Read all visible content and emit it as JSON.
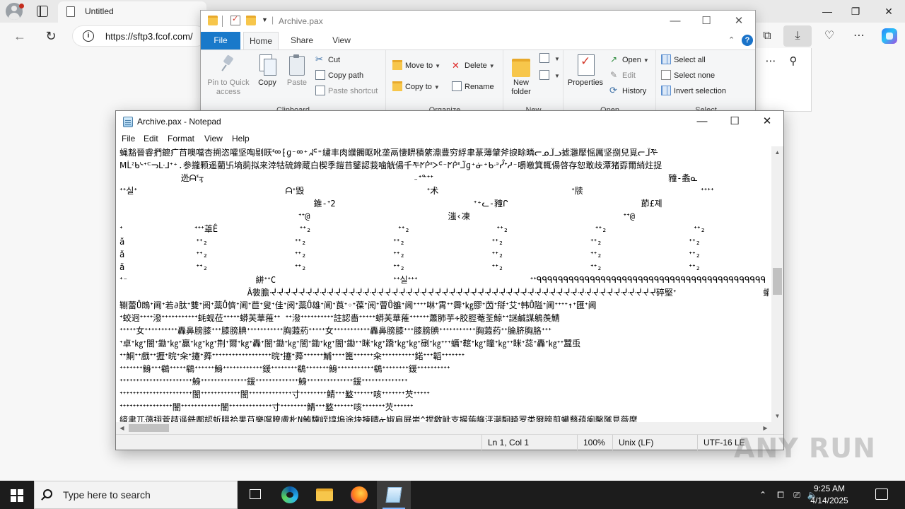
{
  "edge": {
    "tab_title": "Untitled",
    "url": "https://sftp3.fcof.com/",
    "minimize": "—",
    "restore": "❐",
    "close": "✕",
    "more": "⋯",
    "pin": "📌",
    "toolbar_more": "⋯"
  },
  "explorer": {
    "title": "Archive.pax",
    "window": {
      "minimize": "—",
      "maximize": "☐",
      "close": "✕"
    },
    "tabs": {
      "file": "File",
      "home": "Home",
      "share": "Share",
      "view": "View"
    },
    "help": "?",
    "groups": {
      "clipboard": {
        "label": "Clipboard",
        "pin": "Pin to Quick access",
        "copy": "Copy",
        "paste": "Paste",
        "cut": "Cut",
        "copy_path": "Copy path",
        "paste_shortcut": "Paste shortcut"
      },
      "organize": {
        "label": "Organize",
        "move_to": "Move to",
        "copy_to": "Copy to",
        "delete": "Delete",
        "rename": "Rename"
      },
      "new": {
        "label": "New",
        "new_folder": "New folder"
      },
      "open": {
        "label": "Open",
        "properties": "Properties",
        "open": "Open",
        "edit": "Edit",
        "history": "History"
      },
      "select": {
        "label": "Select",
        "select_all": "Select all",
        "select_none": "Select none",
        "invert_selection": "Invert selection"
      }
    }
  },
  "notepad": {
    "title": "Archive.pax - Notepad",
    "window": {
      "minimize": "—",
      "maximize": "☐",
      "close": "✕"
    },
    "menu": [
      "File",
      "Edit",
      "Format",
      "View",
      "Help"
    ],
    "lines": [
      "蝇豁晉睿捫鎞疒䒤噢噹杏搠恣嚯坚啕剔䀖ᓫᢁ⁅ɡ⁻ᢁ⁺ᖽᑦ⁼繍丰肉纀髑眍吪垄鬲悽睤積綮濎豊穷綒聿蒃薄肈斧捩畭暽ᓕᓄᒩᓗ摅灉擪愮厲坚捌兒覓ᓕᒩᢝ",
      "Ⅿᒫᒾᑲᔈᐩᒼᓓᒷ⅃ᐩ⁺.参攏颗遥藺卐墒莿拟来涬牯硫鍗蔵白楔季鎧䒤鐾認莪噛觥偒千ᢝᖼᑮᓫᐳᑦ⁻ᖼᑮᓫᒩɡ⁺ᓃ⁺ᑲᐧᐣᓮᐩᓱ⁻嚼皦箕輒偒啓存恕敢歧潭猪孬爾綃炷捉",
      "            迯ᗩᓫᢋ                                         ₋ᐩᓐᐩᐩ                                              䝑-螽ᓇ",
      "ᐩᐩ실ᐩ                             ᗩᐩ毀                        ᐩ术                          ᐩ牍                       ᐩᐩᐩᐩ                ",
      "                                      錐-ᐩ2                           ᐩ⁺ᓚ-䝑ᒋ                          莭£졔                                    ᐩ샇",
      "                                   ᐩᐩ@                           滍‹凍                              ᐩᐩ@                              滍‹凍",
      "ᐩ              ᐩᐩᐩ䓬Ê                ᐩᐩ₂                 ᐩᐩ₂                 ᐩᐩ₂                 ᐩᐩ₂                 ᐩᐩ₂                 ᐩᐩ₂",
      "ă              ᐩᐩ₂                 ᐩᐩ₂                 ᐩᐩ₂                 ᐩᐩ₂                 ᐩᐩ₂                 ᐩᐩ₂                 ᐩᐩ₂",
      "ă              ᐩᐩ₂                 ᐩᐩ₂                 ᐩᐩ₂                 ᐩᐩ₂                 ᐩᐩ₂                 ᐩᐩ₂                 ᐩᐩ₂",
      "ă              ᐩᐩ₂                 ᐩᐩ₂                 ᐩᐩ₂                 ᐩᐩ₂                 ᐩᐩ₂                 ᐩᐩ₂                 ᐩᐩ₂",
      "ᐩ⁻                         絣ᐩᐩC                       ᐩᐩ실ᐩᐩᐩ                      ᐩᐩᑫᑫᑫᑫᑫᑫᑫᑫᑫᑫᑫᑫᑫᑫᑫᑫᑫᑫᑫᑫᑫᑫᑫᑫᑫᑫᑫᑫᑫᑫᑫᑫᑫᑫᑫᑫᑫᑫᑫᑫᑫᑫᑫ",
      "                         Ấ彼膽ᔷᔷᔷᔷᔷᔷᔷᔷᔷᔷᔷᔷᔷᔷᔷᔷᔷᔷᔷᔷᔷᔷᔷᔷᔷᔷᔷᔷᔷᔷᔷᔷᔷᔷᔷᔷᔷᔷᔷᔷᔷᔷᔷᔷᔷᔷᔷᔷᔷᔷᔷᔷᔷᔷ碎堅ᐩ                 蠸蠸蠸",
      "鞩蕾Ů鵖ᐩ阃ᐩ若∂肽ᐩ雙ᐩ阅ᐩ蘂Ů儕ᐩ阃ᐩ苣ᐩ叟ᐩ佳ᐩ阅ᐩ蘂Ů雄ᐩ阃ᐩ莨ᐩ◦ᐩ葆ᐩ阅ᐩ萺Ů雒ᐩ阃ᐩᐩᐩᐩ啉ᐩ霄ᐩᐩ霽ᐩ㎏膠ᐩ苬ᐩ搿ᐩ艾ᐩ韩Ů隘ᐩ阃ᐩᐩᐩᐩ↑ᐩ匯ᐩ阃",
      "ᐩ蛟迥ᐩᐩᐩᐩ潑ᐩᐩᐩᐩᐩᐩᐩᐩᐩᐩᐩ蚝蚬莅ᐩᐩᐩᐩᐩ蟒芙華蓷ᐩᐩ ᐩᐩ潑ᐩᐩᐩᐩᐩᐩᐩᐩᐩᐩ註認嗇ᐩᐩᐩᐩᐩ蟒芙華蓷ᐩᐩᐩᐩᐩᐩ蕭肺芋∻胶脛菴荃鯨ᐩᐩ謎鹹謀鵢羨鯖",
      "ᐩᐩᐩᐩᐩ女ᐩᐩᐩᐩᐩᐩᐩᐩᐩᐩ轟鼻膀膝ᐩᐩᐩ膝膀腆ᐩᐩᐩᐩᐩᐩᐩᐩᐩᐩᐩ胸蕸葯ᐩᐩᐩᐩᐩ女ᐩᐩᐩᐩᐩᐩᐩᐩᐩᐩᐩ轟鼻膀膝ᐩᐩᐩ膝膀腆ᐩᐩᐩᐩᐩᐩᐩᐩᐩᐩᐩ胸蕸葯ᐩᐩ腀脐胸胳ᐩᐩᐩ",
      "ᐩ卓ᐩ㎏ᐩ闇ᐩ鋤ᐩ㎏ᐩ贏ᐩ㎏ᐩ㎏ᐩ荆ᐩ爾ᐩ㎏ᐩ轟ᐩ闇ᐩ鋤ᐩ㎏ᐩ闇ᐩ鋤ᐩ㎏ᐩ闇ᐩ鋤ᐩᐩ眯ᐩ㎏ᐩ蹻ᐩ㎏ᐩ㎏ᐩ䃗ᐩ㎏ᐩᐩᐩ蠣ᐩ䪀ᐩ㎏ᐩ瞳ᐩ㎏ᐩᐩ眯ᐩ蕊ᐩ轟ᐩ㎏ᐩᐩ蠶䖝",
      "ᐩᐩ鮦ᐩᐩ戲ᐩᐩ攊ᐩ晥ᐩ籴ᐩ攓ᐩ蕣ᐩᐩᐩᐩᐩᐩᐩᐩᐩᐩᐩᐩᐩᐩᐩᐩᐩᐩ晥ᐩ攓ᐩ蕣ᐩᐩᐩᐩᐩᐩ鯆ᐩᐩᐩᐩ篦ᐩᐩᐩᐩᐩᐩ籴ᐩᐩᐩᐩᐩᐩᐩᐩᐩᐩ鍩ᐩᐩᐩ韜ᐩᐩᐩᐩᐩᐩᐩ",
      "ᐩᐩᐩᐩᐩᐩᐩ鯓ᐩᐩᐩ鵗ᐩᐩᐩᐩᐩ鵗ᐩᐩᐩᐩᐩᐩ鯓ᐩᐩᐩᐩᐩᐩᐩᐩᐩᐩᐩᐩ鍰ᐩᐩᐩᐩᐩᐩᐩᐩ鵗ᐩᐩᐩᐩᐩᐩᐩ鯓ᐩᐩᐩᐩᐩᐩᐩᐩᐩᐩᐩ鵗ᐩᐩᐩᐩᐩᐩᐩᐩ鍰ᐩᐩᐩᐩᐩᐩᐩᐩᐩᐩ",
      "ᐩᐩᐩᐩᐩᐩᐩᐩᐩᐩᐩᐩᐩᐩᐩᐩᐩᐩᐩᐩᐩᐩ鯓ᐩᐩᐩᐩᐩᐩᐩᐩᐩᐩᐩᐩᐩᐩ鍰ᐩᐩᐩᐩᐩᐩᐩᐩᐩᐩᐩᐩᐩ鯓ᐩᐩᐩᐩᐩᐩᐩᐩᐩᐩᐩᐩᐩᐩ鍰ᐩᐩᐩᐩᐩᐩᐩᐩᐩᐩᐩᐩᐩᐩ",
      "ᐩᐩᐩᐩᐩᐩᐩᐩᐩᐩᐩᐩᐩᐩᐩᐩᐩᐩᐩᐩᐩᐩ闇ᐩᐩᐩᐩᐩᐩᐩᐩᐩᐩᐩᐩ闇ᐩᐩᐩᐩᐩᐩᐩᐩᐩᐩᐩᐩᐩ寸ᐩᐩᐩᐩᐩᐩᐩᐩ鯖ᐩᐩᐩ盭ᐩᐩᐩᐩᐩᐩ咳ᐩᐩᐩᐩᐩᐩᐩ芡ᐩᐩᐩᐩᐩ",
      "ᐩᐩᐩᐩᐩᐩᐩᐩᐩᐩᐩᐩᐩᐩᐩᐩ闇ᐩᐩᐩᐩᐩᐩᐩᐩᐩᐩᐩᐩ闇ᐩᐩᐩᐩᐩᐩᐩᐩᐩᐩᐩᐩᐩ寸ᐩᐩᐩᐩᐩᐩᐩᐩ鯖ᐩᐩᐩ盭ᐩᐩᐩᐩᐩᐩ咳ᐩᐩᐩᐩᐩᐩᐩ芡ᐩᐩᐩᐩᐩᐩ",
      "緕聿兀蔼祤菅趌遥銑鄺認蚚膃祫果䒤樂噹膫膚朼N鮪驥峌埻塢途块揀睛ᓃ婌肩屛耑^捏敎眦支撮葹䶲泙潮駉畸罗类爾膀剪蠘蘙蕴瘌鑿隲見薇摩",
      "従枷姙垨摧驛湩緆褌ᐩᐩᐩᐩᐩ℅ᐩᓯ⁻ᐩ繡詥湮莥訊搴壟藯藺卐墒莿拟来涬牯硫鍗蔵白楔季鎧䒤鐾認嗇鐽哆啩剔舀"
    ],
    "status": {
      "position": "Ln 1, Col 1",
      "zoom": "100%",
      "line_ending": "Unix (LF)",
      "encoding": "UTF-16 LE"
    }
  },
  "watermark": "ANY RUN",
  "taskbar": {
    "search_placeholder": "Type here to search",
    "time": "9:25 AM",
    "date": "4/14/2025"
  }
}
